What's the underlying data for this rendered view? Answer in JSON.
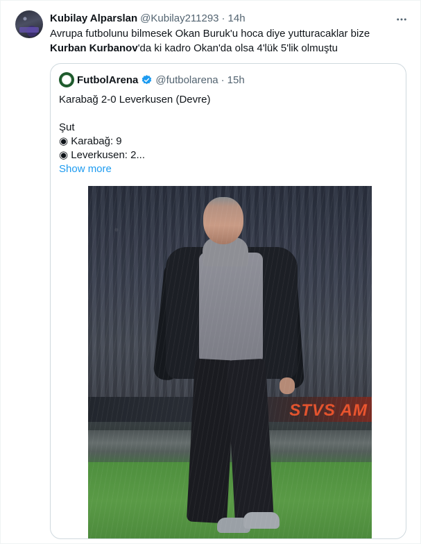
{
  "tweet": {
    "author_name": "Kubilay Alparslan",
    "author_handle": "@Kubilay211293",
    "separator": "·",
    "time": "14h",
    "text_line1": "Avrupa futbolunu bilmesek Okan Buruk'u hoca diye yutturacaklar bize",
    "text_bold": "Kurban Kurbanov",
    "text_line2_rest": "'da ki kadro Okan'da olsa 4'lük 5'lik olmuştu",
    "more_icon": "more-horizontal-icon"
  },
  "quote": {
    "author_name": "FutbolArena",
    "verified_icon": "verified-badge-icon",
    "author_handle": "@futbolarena",
    "separator": "·",
    "time": "15h",
    "line1": "Karabağ 2-0 Leverkusen (Devre)",
    "line2": "Şut",
    "line3": "◉ Karabağ: 9",
    "line4": "◉ Leverkusen: 2...",
    "show_more": "Show more",
    "photo": {
      "ad_text": "STVS AM"
    }
  },
  "colors": {
    "text": "#0f1419",
    "muted": "#536471",
    "link": "#1d9bf0",
    "border": "#cfd9de"
  }
}
